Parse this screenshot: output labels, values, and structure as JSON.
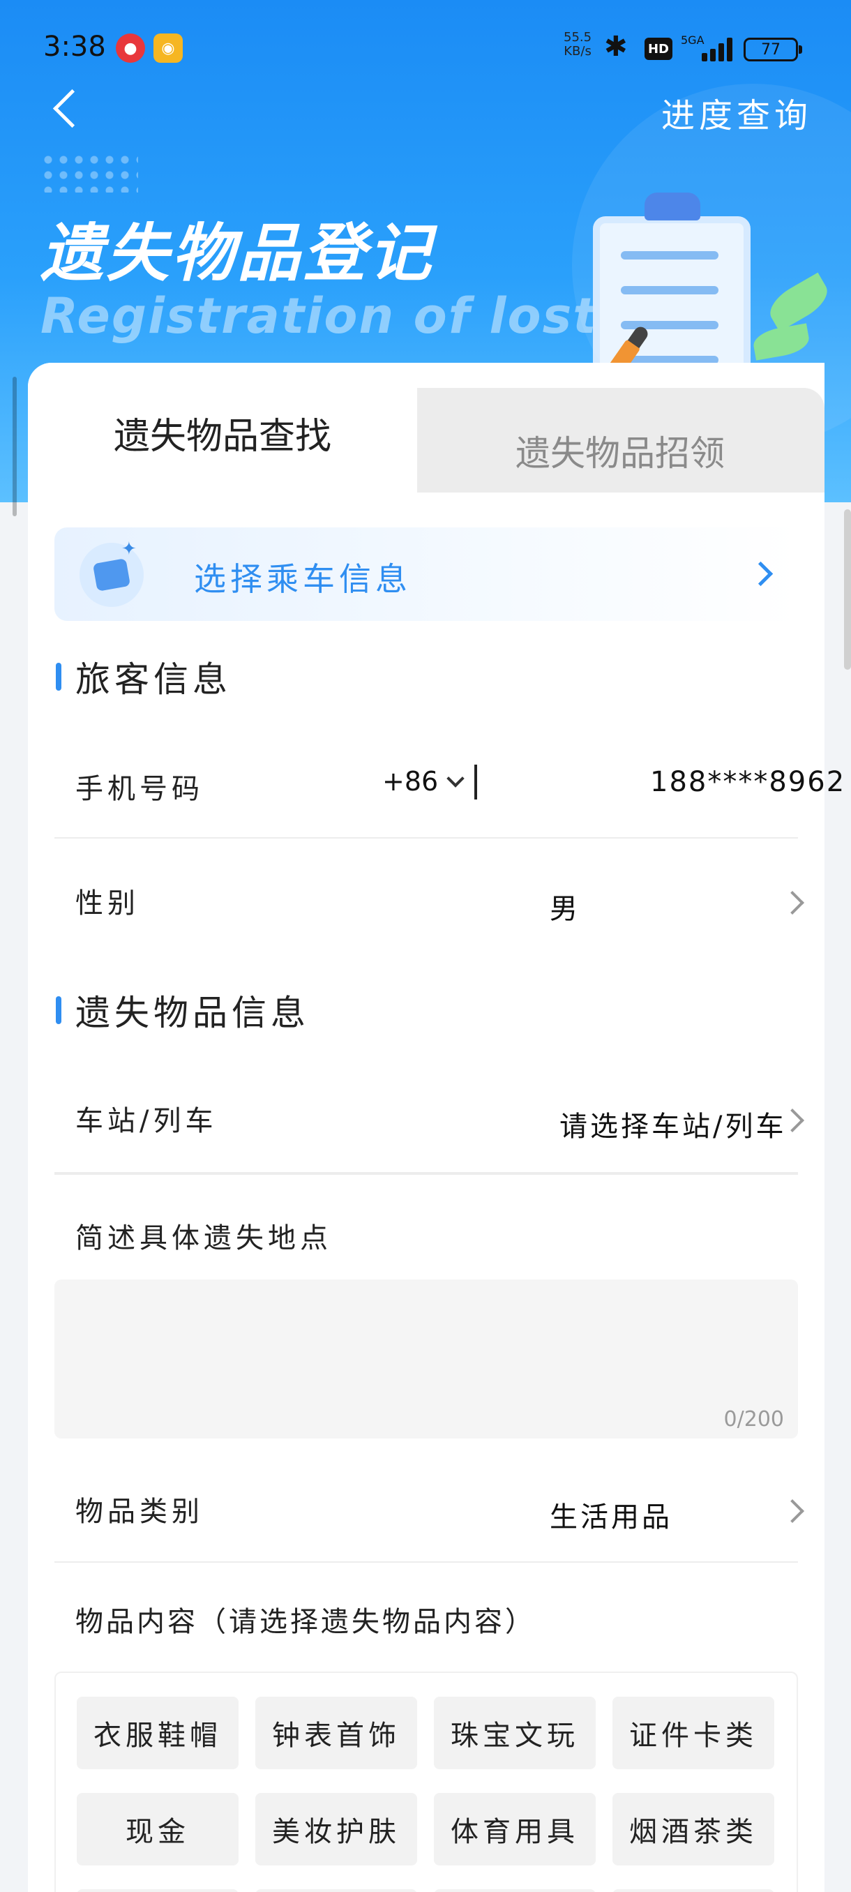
{
  "status_bar": {
    "time": "3:38",
    "net_speed_value": "55.5",
    "net_speed_unit": "KB/s",
    "hd": "HD",
    "network": "5GA",
    "battery": "77"
  },
  "header": {
    "back_icon": "chevron-left-icon",
    "progress_query": "进度查询",
    "hero_title": "遗失物品登记",
    "hero_subtitle": "Registration of lost"
  },
  "tabs": [
    {
      "label": "遗失物品查找",
      "active": true
    },
    {
      "label": "遗失物品招领",
      "active": false
    }
  ],
  "trip_selector": {
    "label": "选择乘车信息",
    "icon": "ticket-icon"
  },
  "passenger_section": {
    "title": "旅客信息",
    "phone_label": "手机号码",
    "country_code": "+86",
    "phone_value": "188****8962",
    "gender_label": "性别",
    "gender_value": "男"
  },
  "lost_item_section": {
    "title": "遗失物品信息",
    "station_label": "车站/列车",
    "station_placeholder": "请选择车站/列车",
    "location_label": "简述具体遗失地点",
    "location_counter": "0/200",
    "category_label": "物品类别",
    "category_value": "生活用品",
    "content_label": "物品内容（请选择遗失物品内容）",
    "content_options": [
      "衣服鞋帽",
      "钟表首饰",
      "珠宝文玩",
      "证件卡类",
      "现金",
      "美妆护肤",
      "体育用具",
      "烟酒茶类"
    ]
  },
  "colors": {
    "accent": "#2f8ef1",
    "hero_top": "#1b8cf5",
    "chip_bg": "#f2f2f2"
  }
}
